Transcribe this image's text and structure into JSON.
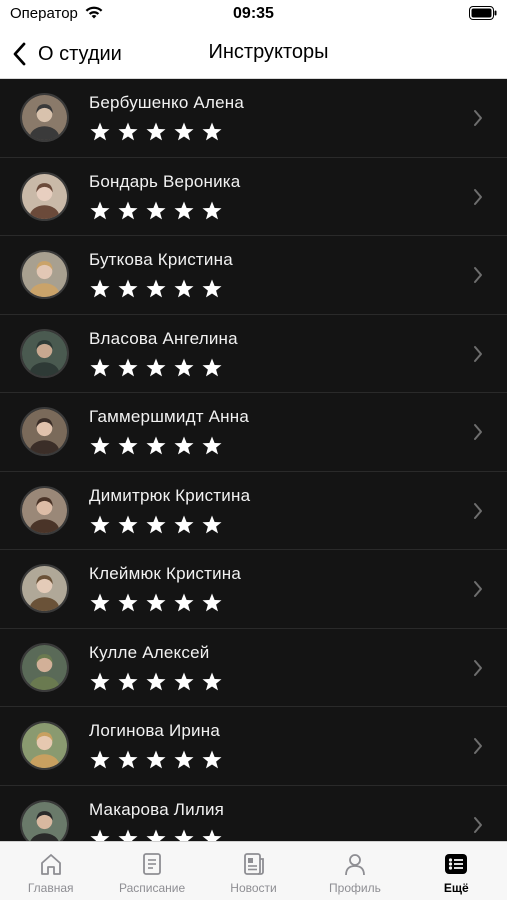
{
  "status_bar": {
    "carrier": "Оператор",
    "time": "09:35"
  },
  "nav": {
    "back_label": "О студии",
    "title": "Инструкторы"
  },
  "instructors": [
    {
      "name": "Бербушенко Алена",
      "rating": 5
    },
    {
      "name": "Бондарь Вероника",
      "rating": 5
    },
    {
      "name": "Буткова Кристина",
      "rating": 5
    },
    {
      "name": "Власова Ангелина",
      "rating": 5
    },
    {
      "name": "Гаммершмидт Анна",
      "rating": 5
    },
    {
      "name": "Димитрюк Кристина",
      "rating": 5
    },
    {
      "name": "Клеймюк Кристина",
      "rating": 5
    },
    {
      "name": "Кулле Алексей",
      "rating": 5
    },
    {
      "name": "Логинова Ирина",
      "rating": 5
    },
    {
      "name": "Макарова Лилия",
      "rating": 5
    }
  ],
  "tabs": [
    {
      "label": "Главная",
      "icon": "home-icon",
      "active": false
    },
    {
      "label": "Расписание",
      "icon": "schedule-icon",
      "active": false
    },
    {
      "label": "Новости",
      "icon": "news-icon",
      "active": false
    },
    {
      "label": "Профиль",
      "icon": "profile-icon",
      "active": false
    },
    {
      "label": "Ещё",
      "icon": "more-list-icon",
      "active": true
    }
  ],
  "colors": {
    "list_bg": "#141414",
    "star": "#ffffff",
    "tab_inactive": "#8e8e93",
    "tab_active": "#000000"
  }
}
